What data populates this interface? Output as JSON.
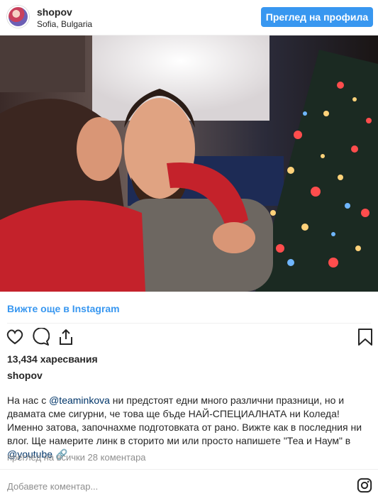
{
  "header": {
    "username": "shopov",
    "location": "Sofia, Bulgaria",
    "view_profile_label": "Преглед на профила"
  },
  "post": {
    "see_more_label": "Вижте още в Instagram",
    "likes_text": "13,434 харесвания",
    "caption_user": "shopov",
    "caption_part1": "На нас с ",
    "mention1": "@teaminkova",
    "caption_part2": " ни предстоят едни много различни празници, но и двамата сме сигурни, че това ще бъде НАЙ-СПЕЦИАЛНАТА ни Коледа! Именно затова, започнахме подготовката от рано. Вижте как в последния ни влог. Ще намерите линк в сторито ми или просто напишете \"Теа и Наум\" в ",
    "mention2": "@youtube",
    "caption_emoji": "🔗",
    "comments_link": "преглед на всички 28 коментара",
    "add_comment_placeholder": "Добавете коментар..."
  },
  "icons": [
    "avatar",
    "heart-icon",
    "comment-icon",
    "share-icon",
    "bookmark-icon",
    "instagram-logo-icon"
  ],
  "colors": {
    "accent": "#3897f0",
    "text": "#262626",
    "muted": "#8e8e8e",
    "mention": "#003569"
  }
}
